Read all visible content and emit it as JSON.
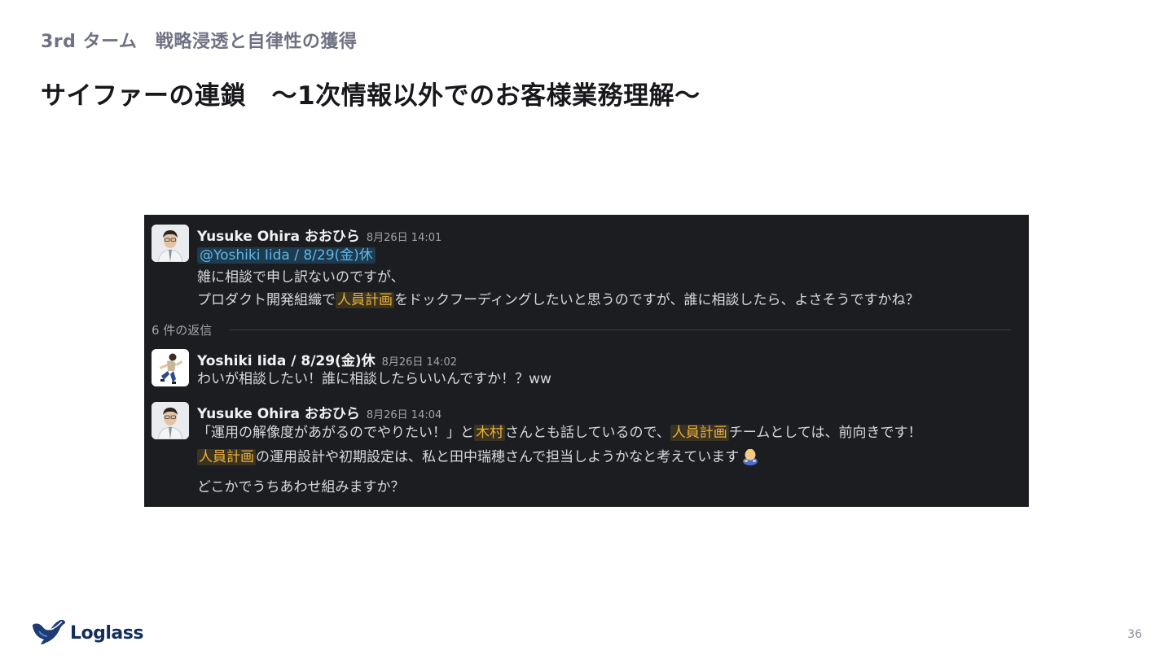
{
  "slide": {
    "subtitle": "3rd ターム　戦略浸透と自律性の獲得",
    "title": "サイファーの連鎖　〜1次情報以外でのお客様業務理解〜",
    "page_number": "36",
    "logo_text": "Loglass"
  },
  "thread": {
    "replies_label": "6 件の返信",
    "parent": {
      "author": "Yusuke Ohira おおひら",
      "timestamp": "8月26日 14:01",
      "mention": "@Yoshiki Iida / 8/29(金)休",
      "line1": "雑に相談で申し訳ないのですが、",
      "line2_before": "プロダクト開発組織で",
      "line2_highlight": "人員計画",
      "line2_after": "をドックフーディングしたいと思うのですが、誰に相談したら、よさそうですかね？"
    },
    "reply1": {
      "author": "Yoshiki Iida / 8/29(金)休",
      "timestamp": "8月26日 14:02",
      "line1": "わいが相談したい！誰に相談したらいいんですか！？ww"
    },
    "reply2": {
      "author": "Yusuke Ohira おおひら",
      "timestamp": "8月26日 14:04",
      "line1_part1": "「運用の解像度があがるのでやりたい！」と",
      "line1_highlight1": "木村",
      "line1_part2": "さんとも話しているので、",
      "line1_highlight2": "人員計画",
      "line1_part3": "チームとしては、前向きです！",
      "line2_highlight": "人員計画",
      "line2_after": "の運用設計や初期設定は、私と田中瑞穂さんで担当しようかなと考えています",
      "line3": "どこかでうちあわせ組みますか？"
    }
  },
  "colors": {
    "slack_bg": "#1b1d21",
    "mention": "#5fb7e8",
    "highlight": "#e8b03b",
    "logo": "#142e5c"
  },
  "icons": {
    "emoji": "bowing-person-emoji",
    "logo": "loglass-bird-logo"
  }
}
